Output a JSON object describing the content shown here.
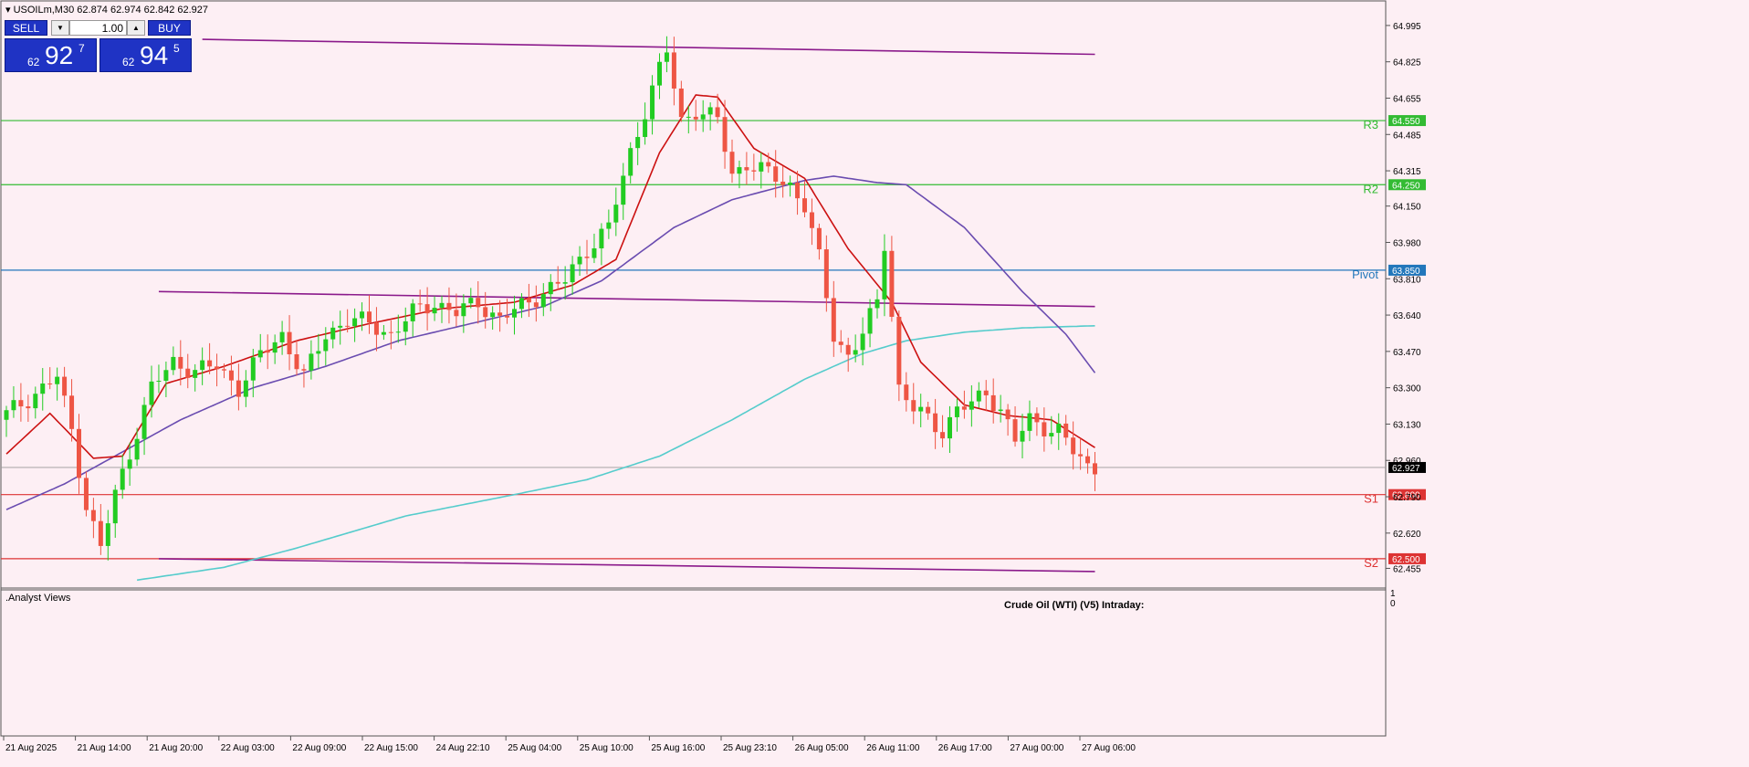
{
  "header": {
    "symbol": "USOILm,M30",
    "ohlc": "62.874 62.974 62.842 62.927"
  },
  "trade_panel": {
    "sell_label": "SELL",
    "buy_label": "BUY",
    "volume": "1.00",
    "sell_price": {
      "small": "62",
      "big": "92",
      "sup": "7"
    },
    "buy_price": {
      "small": "62",
      "big": "94",
      "sup": "5"
    }
  },
  "colors": {
    "background": "#fdeff4",
    "bull": "#22cc22",
    "bear": "#ee5544",
    "ma_fast": "#cc1111",
    "ma_mid": "#6a4cb0",
    "ma_slow": "#55cccc",
    "channel": "#8b1a8b",
    "resistance": "#33bb33",
    "pivot": "#2277bb",
    "support": "#dd3333"
  },
  "subwindow": {
    "label": ".Analyst Views",
    "scale_top": "1",
    "scale_bottom": "0",
    "caption": "Crude Oil (WTI) (V5) Intraday:"
  },
  "chart_data": {
    "type": "candlestick",
    "timeframe": "M30",
    "ylim": [
      62.38,
      65.08
    ],
    "yticks": [
      "64.995",
      "64.825",
      "64.655",
      "64.485",
      "64.315",
      "64.150",
      "63.980",
      "63.810",
      "63.640",
      "63.470",
      "63.300",
      "63.130",
      "62.960",
      "62.790",
      "62.620",
      "62.455"
    ],
    "xticks": [
      "21 Aug 2025",
      "21 Aug 14:00",
      "21 Aug 20:00",
      "22 Aug 03:00",
      "22 Aug 09:00",
      "22 Aug 15:00",
      "24 Aug 22:10",
      "25 Aug 04:00",
      "25 Aug 10:00",
      "25 Aug 16:00",
      "25 Aug 23:10",
      "26 Aug 05:00",
      "26 Aug 11:00",
      "26 Aug 17:00",
      "27 Aug 00:00",
      "27 Aug 06:00"
    ],
    "current_price": "62.927",
    "levels": [
      {
        "name": "R3",
        "price": "64.550",
        "kind": "resistance"
      },
      {
        "name": "R2",
        "price": "64.250",
        "kind": "resistance"
      },
      {
        "name": "Pivot",
        "price": "63.850",
        "kind": "pivot"
      },
      {
        "name": "S1",
        "price": "62.800",
        "kind": "support"
      },
      {
        "name": "S2",
        "price": "62.500",
        "kind": "support"
      }
    ],
    "anchors": [
      [
        0,
        63.15
      ],
      [
        4,
        63.25
      ],
      [
        8,
        63.35
      ],
      [
        10,
        63.1
      ],
      [
        12,
        62.75
      ],
      [
        14,
        62.55
      ],
      [
        16,
        62.8
      ],
      [
        18,
        63.0
      ],
      [
        21,
        63.3
      ],
      [
        24,
        63.42
      ],
      [
        27,
        63.38
      ],
      [
        30,
        63.4
      ],
      [
        33,
        63.3
      ],
      [
        36,
        63.45
      ],
      [
        39,
        63.55
      ],
      [
        42,
        63.35
      ],
      [
        45,
        63.55
      ],
      [
        48,
        63.62
      ],
      [
        51,
        63.6
      ],
      [
        54,
        63.55
      ],
      [
        57,
        63.65
      ],
      [
        60,
        63.7
      ],
      [
        63,
        63.65
      ],
      [
        66,
        63.7
      ],
      [
        69,
        63.62
      ],
      [
        72,
        63.68
      ],
      [
        75,
        63.75
      ],
      [
        78,
        63.8
      ],
      [
        81,
        63.95
      ],
      [
        84,
        64.05
      ],
      [
        87,
        64.4
      ],
      [
        90,
        64.7
      ],
      [
        92,
        64.87
      ],
      [
        94,
        64.55
      ],
      [
        96,
        64.6
      ],
      [
        99,
        64.55
      ],
      [
        101,
        64.3
      ],
      [
        103,
        64.35
      ],
      [
        106,
        64.3
      ],
      [
        109,
        64.25
      ],
      [
        111,
        64.15
      ],
      [
        113,
        63.9
      ],
      [
        115,
        63.55
      ],
      [
        117,
        63.45
      ],
      [
        119,
        63.55
      ],
      [
        121,
        63.7
      ],
      [
        122,
        63.98
      ],
      [
        123,
        63.65
      ],
      [
        124,
        63.3
      ],
      [
        126,
        63.2
      ],
      [
        128,
        63.15
      ],
      [
        130,
        63.1
      ],
      [
        132,
        63.2
      ],
      [
        134,
        63.22
      ],
      [
        136,
        63.28
      ],
      [
        138,
        63.2
      ],
      [
        140,
        63.05
      ],
      [
        142,
        63.15
      ],
      [
        144,
        63.12
      ],
      [
        146,
        63.1
      ],
      [
        148,
        63.0
      ],
      [
        150,
        62.93
      ]
    ],
    "candles": 151,
    "moving_averages": {
      "fast": [
        [
          0,
          62.99
        ],
        [
          6,
          63.18
        ],
        [
          12,
          62.97
        ],
        [
          16,
          62.98
        ],
        [
          22,
          63.32
        ],
        [
          30,
          63.4
        ],
        [
          40,
          63.52
        ],
        [
          50,
          63.6
        ],
        [
          60,
          63.67
        ],
        [
          70,
          63.7
        ],
        [
          78,
          63.78
        ],
        [
          84,
          63.9
        ],
        [
          90,
          64.4
        ],
        [
          95,
          64.67
        ],
        [
          98,
          64.66
        ],
        [
          103,
          64.42
        ],
        [
          110,
          64.28
        ],
        [
          116,
          63.95
        ],
        [
          122,
          63.7
        ],
        [
          126,
          63.42
        ],
        [
          132,
          63.22
        ],
        [
          138,
          63.17
        ],
        [
          144,
          63.15
        ],
        [
          150,
          63.02
        ]
      ],
      "mid": [
        [
          0,
          62.73
        ],
        [
          8,
          62.85
        ],
        [
          16,
          63.0
        ],
        [
          24,
          63.15
        ],
        [
          34,
          63.3
        ],
        [
          44,
          63.4
        ],
        [
          54,
          63.52
        ],
        [
          64,
          63.6
        ],
        [
          74,
          63.68
        ],
        [
          82,
          63.8
        ],
        [
          92,
          64.05
        ],
        [
          100,
          64.18
        ],
        [
          110,
          64.27
        ],
        [
          114,
          64.29
        ],
        [
          120,
          64.26
        ],
        [
          124,
          64.25
        ],
        [
          132,
          64.05
        ],
        [
          140,
          63.75
        ],
        [
          146,
          63.55
        ],
        [
          150,
          63.37
        ]
      ],
      "slow": [
        [
          18,
          62.4
        ],
        [
          30,
          62.46
        ],
        [
          40,
          62.55
        ],
        [
          55,
          62.7
        ],
        [
          70,
          62.8
        ],
        [
          80,
          62.87
        ],
        [
          90,
          62.98
        ],
        [
          100,
          63.15
        ],
        [
          110,
          63.34
        ],
        [
          118,
          63.46
        ],
        [
          124,
          63.52
        ],
        [
          132,
          63.56
        ],
        [
          140,
          63.58
        ],
        [
          150,
          63.59
        ]
      ]
    },
    "channel_lines": [
      {
        "x": [
          27,
          150
        ],
        "y": [
          64.93,
          64.86
        ]
      },
      {
        "x": [
          21,
          150
        ],
        "y": [
          63.75,
          63.68
        ]
      },
      {
        "x": [
          21,
          150
        ],
        "y": [
          62.5,
          62.44
        ]
      }
    ]
  }
}
